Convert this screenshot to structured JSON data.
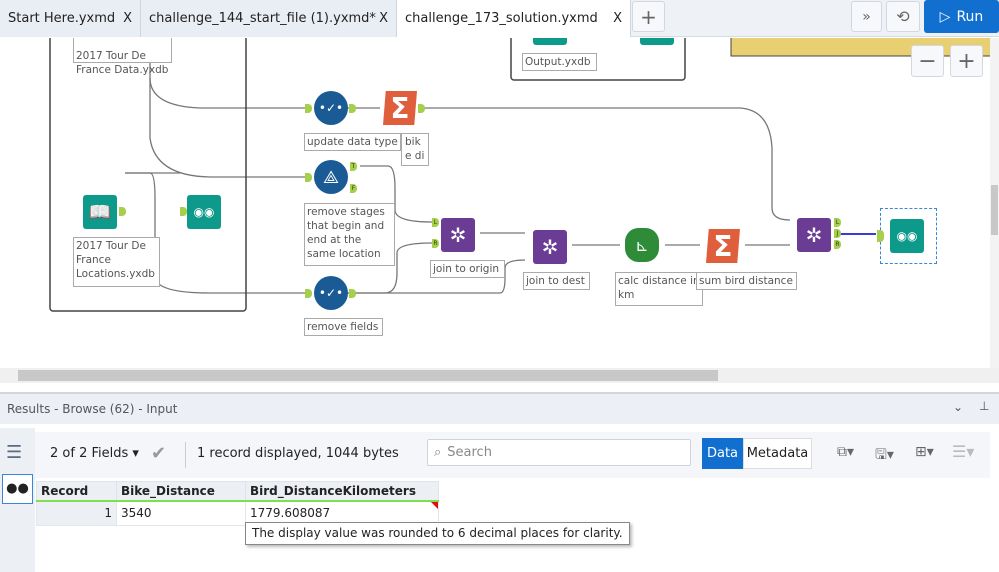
{
  "tabs": [
    {
      "label": "Start Here.yxmd",
      "close": "X"
    },
    {
      "label": "challenge_144_start_file (1).yxmd*",
      "close": "X"
    },
    {
      "label": "challenge_173_solution.yxmd",
      "close": "X",
      "active": true
    }
  ],
  "toolbar": {
    "add_tab": "+",
    "more": "»",
    "history_icon": "history-icon",
    "run_label": "Run"
  },
  "canvas": {
    "zoom_out": "−",
    "zoom_in": "+",
    "tools": {
      "input_data_label": "2017 Tour De France Data.yxdb",
      "output_label": "Output.yxdb",
      "update_type_label": "update data type",
      "sum_bike_label": "bike distance",
      "filter_label": "remove stages that begin and end at the same location",
      "filter_true": "T",
      "filter_false": "F",
      "locations_label": "2017 Tour De France Locations.yxdb",
      "remove_fields_label": "remove fields",
      "join_origin_label": "join to origin",
      "join_dest_label": "join to dest",
      "calc_label": "calc distance in km",
      "sum_bird_label": "sum bird distance",
      "join_l": "L",
      "join_j": "J",
      "join_r": "R"
    }
  },
  "results": {
    "title": "Results - Browse (62) - Input",
    "fields_selector": "2 of 2 Fields",
    "record_info": "1 record displayed, 1044 bytes",
    "search_placeholder": "Search",
    "data_tab": "Data",
    "metadata_tab": "Metadata",
    "columns": [
      "Record",
      "Bike_Distance",
      "Bird_DistanceKilometers"
    ],
    "rows": [
      [
        "1",
        "3540",
        "1779.608087"
      ]
    ],
    "tooltip": "The display value was rounded to 6 decimal places for clarity."
  },
  "colors": {
    "run": "#1170cf",
    "connector": "#a6cf4c",
    "selected_line": "#3b3bdc"
  }
}
